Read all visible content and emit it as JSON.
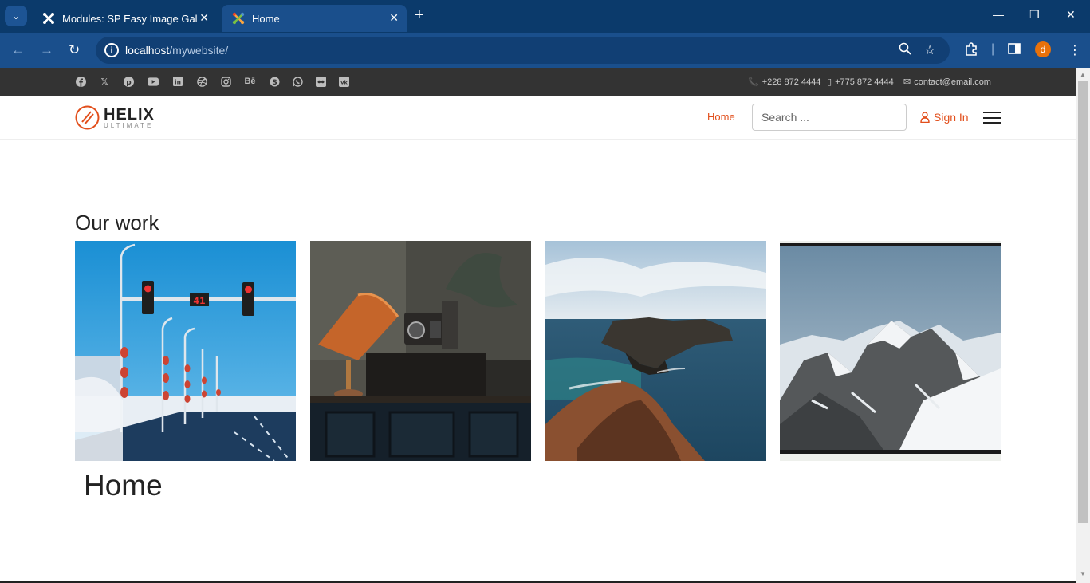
{
  "browser": {
    "tabs": [
      {
        "title": "Modules: SP Easy Image Gallery",
        "active": false
      },
      {
        "title": "Home",
        "active": true
      }
    ],
    "new_tab_symbol": "+",
    "url_host": "localhost",
    "url_path": "/mywebsite/",
    "profile_initial": "d"
  },
  "topbar": {
    "social_icons": [
      "facebook-icon",
      "x-icon",
      "pinterest-icon",
      "youtube-icon",
      "linkedin-icon",
      "dribbble-icon",
      "instagram-icon",
      "behance-icon",
      "skype-icon",
      "whatsapp-icon",
      "flickr-icon",
      "vk-icon"
    ],
    "phone": "+228 872 4444",
    "mobile": "+775 872 4444",
    "email": "contact@email.com"
  },
  "header": {
    "logo_main": "HELIX",
    "logo_sub": "ULTIMATE",
    "menu_home": "Home",
    "search_placeholder": "Search ...",
    "signin_label": "Sign In"
  },
  "main": {
    "section_title": "Our work",
    "gallery": [
      "traffic-lights-winter-street",
      "lamp-and-radio",
      "coastal-cliffs",
      "snowy-mountains"
    ],
    "page_heading": "Home"
  },
  "colors": {
    "accent": "#e24f1c",
    "browser_frame": "#0b3a6b",
    "topbar": "#333333"
  }
}
